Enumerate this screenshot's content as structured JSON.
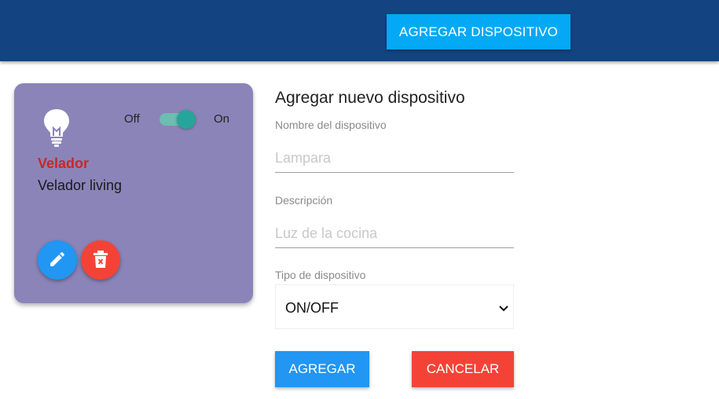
{
  "header": {
    "add_device_label": "AGREGAR DISPOSITIVO",
    "background_color": "#134481",
    "button_color": "#03a9f4"
  },
  "device_card": {
    "icon": "lightbulb-icon",
    "toggle_off_label": "Off",
    "toggle_on_label": "On",
    "toggle_state": "on",
    "name": "Velador",
    "description": "Velador living",
    "edit_icon": "pencil-icon",
    "delete_icon": "trash-icon",
    "card_color": "#8b84b8"
  },
  "form": {
    "title": "Agregar nuevo dispositivo",
    "name_label": "Nombre del dispositivo",
    "name_placeholder": "Lampara",
    "description_label": "Descripción",
    "description_placeholder": "Luz de la cocina",
    "type_label": "Tipo de dispositivo",
    "type_selected": "ON/OFF",
    "submit_label": "AGREGAR",
    "cancel_label": "CANCELAR"
  }
}
